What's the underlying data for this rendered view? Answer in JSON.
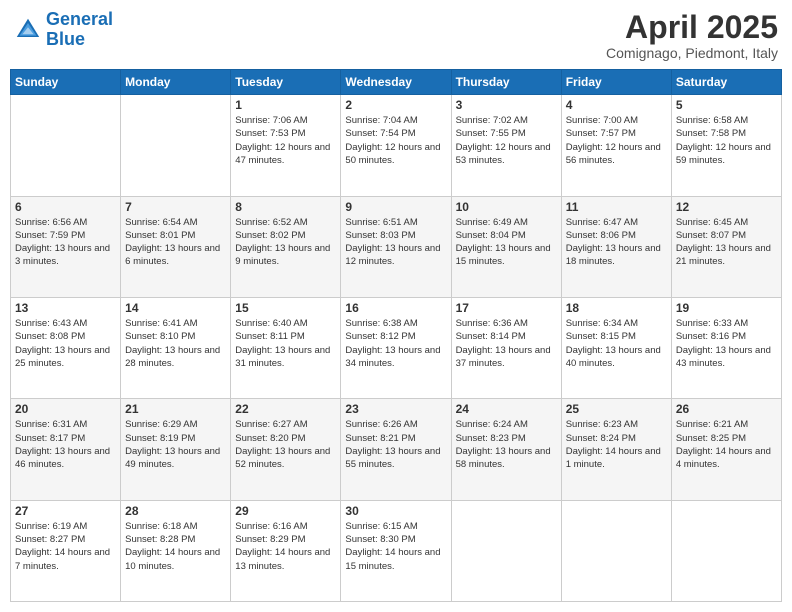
{
  "logo": {
    "line1": "General",
    "line2": "Blue"
  },
  "header": {
    "month": "April 2025",
    "location": "Comignago, Piedmont, Italy"
  },
  "weekdays": [
    "Sunday",
    "Monday",
    "Tuesday",
    "Wednesday",
    "Thursday",
    "Friday",
    "Saturday"
  ],
  "weeks": [
    [
      {
        "day": "",
        "sunrise": "",
        "sunset": "",
        "daylight": ""
      },
      {
        "day": "",
        "sunrise": "",
        "sunset": "",
        "daylight": ""
      },
      {
        "day": "1",
        "sunrise": "Sunrise: 7:06 AM",
        "sunset": "Sunset: 7:53 PM",
        "daylight": "Daylight: 12 hours and 47 minutes."
      },
      {
        "day": "2",
        "sunrise": "Sunrise: 7:04 AM",
        "sunset": "Sunset: 7:54 PM",
        "daylight": "Daylight: 12 hours and 50 minutes."
      },
      {
        "day": "3",
        "sunrise": "Sunrise: 7:02 AM",
        "sunset": "Sunset: 7:55 PM",
        "daylight": "Daylight: 12 hours and 53 minutes."
      },
      {
        "day": "4",
        "sunrise": "Sunrise: 7:00 AM",
        "sunset": "Sunset: 7:57 PM",
        "daylight": "Daylight: 12 hours and 56 minutes."
      },
      {
        "day": "5",
        "sunrise": "Sunrise: 6:58 AM",
        "sunset": "Sunset: 7:58 PM",
        "daylight": "Daylight: 12 hours and 59 minutes."
      }
    ],
    [
      {
        "day": "6",
        "sunrise": "Sunrise: 6:56 AM",
        "sunset": "Sunset: 7:59 PM",
        "daylight": "Daylight: 13 hours and 3 minutes."
      },
      {
        "day": "7",
        "sunrise": "Sunrise: 6:54 AM",
        "sunset": "Sunset: 8:01 PM",
        "daylight": "Daylight: 13 hours and 6 minutes."
      },
      {
        "day": "8",
        "sunrise": "Sunrise: 6:52 AM",
        "sunset": "Sunset: 8:02 PM",
        "daylight": "Daylight: 13 hours and 9 minutes."
      },
      {
        "day": "9",
        "sunrise": "Sunrise: 6:51 AM",
        "sunset": "Sunset: 8:03 PM",
        "daylight": "Daylight: 13 hours and 12 minutes."
      },
      {
        "day": "10",
        "sunrise": "Sunrise: 6:49 AM",
        "sunset": "Sunset: 8:04 PM",
        "daylight": "Daylight: 13 hours and 15 minutes."
      },
      {
        "day": "11",
        "sunrise": "Sunrise: 6:47 AM",
        "sunset": "Sunset: 8:06 PM",
        "daylight": "Daylight: 13 hours and 18 minutes."
      },
      {
        "day": "12",
        "sunrise": "Sunrise: 6:45 AM",
        "sunset": "Sunset: 8:07 PM",
        "daylight": "Daylight: 13 hours and 21 minutes."
      }
    ],
    [
      {
        "day": "13",
        "sunrise": "Sunrise: 6:43 AM",
        "sunset": "Sunset: 8:08 PM",
        "daylight": "Daylight: 13 hours and 25 minutes."
      },
      {
        "day": "14",
        "sunrise": "Sunrise: 6:41 AM",
        "sunset": "Sunset: 8:10 PM",
        "daylight": "Daylight: 13 hours and 28 minutes."
      },
      {
        "day": "15",
        "sunrise": "Sunrise: 6:40 AM",
        "sunset": "Sunset: 8:11 PM",
        "daylight": "Daylight: 13 hours and 31 minutes."
      },
      {
        "day": "16",
        "sunrise": "Sunrise: 6:38 AM",
        "sunset": "Sunset: 8:12 PM",
        "daylight": "Daylight: 13 hours and 34 minutes."
      },
      {
        "day": "17",
        "sunrise": "Sunrise: 6:36 AM",
        "sunset": "Sunset: 8:14 PM",
        "daylight": "Daylight: 13 hours and 37 minutes."
      },
      {
        "day": "18",
        "sunrise": "Sunrise: 6:34 AM",
        "sunset": "Sunset: 8:15 PM",
        "daylight": "Daylight: 13 hours and 40 minutes."
      },
      {
        "day": "19",
        "sunrise": "Sunrise: 6:33 AM",
        "sunset": "Sunset: 8:16 PM",
        "daylight": "Daylight: 13 hours and 43 minutes."
      }
    ],
    [
      {
        "day": "20",
        "sunrise": "Sunrise: 6:31 AM",
        "sunset": "Sunset: 8:17 PM",
        "daylight": "Daylight: 13 hours and 46 minutes."
      },
      {
        "day": "21",
        "sunrise": "Sunrise: 6:29 AM",
        "sunset": "Sunset: 8:19 PM",
        "daylight": "Daylight: 13 hours and 49 minutes."
      },
      {
        "day": "22",
        "sunrise": "Sunrise: 6:27 AM",
        "sunset": "Sunset: 8:20 PM",
        "daylight": "Daylight: 13 hours and 52 minutes."
      },
      {
        "day": "23",
        "sunrise": "Sunrise: 6:26 AM",
        "sunset": "Sunset: 8:21 PM",
        "daylight": "Daylight: 13 hours and 55 minutes."
      },
      {
        "day": "24",
        "sunrise": "Sunrise: 6:24 AM",
        "sunset": "Sunset: 8:23 PM",
        "daylight": "Daylight: 13 hours and 58 minutes."
      },
      {
        "day": "25",
        "sunrise": "Sunrise: 6:23 AM",
        "sunset": "Sunset: 8:24 PM",
        "daylight": "Daylight: 14 hours and 1 minute."
      },
      {
        "day": "26",
        "sunrise": "Sunrise: 6:21 AM",
        "sunset": "Sunset: 8:25 PM",
        "daylight": "Daylight: 14 hours and 4 minutes."
      }
    ],
    [
      {
        "day": "27",
        "sunrise": "Sunrise: 6:19 AM",
        "sunset": "Sunset: 8:27 PM",
        "daylight": "Daylight: 14 hours and 7 minutes."
      },
      {
        "day": "28",
        "sunrise": "Sunrise: 6:18 AM",
        "sunset": "Sunset: 8:28 PM",
        "daylight": "Daylight: 14 hours and 10 minutes."
      },
      {
        "day": "29",
        "sunrise": "Sunrise: 6:16 AM",
        "sunset": "Sunset: 8:29 PM",
        "daylight": "Daylight: 14 hours and 13 minutes."
      },
      {
        "day": "30",
        "sunrise": "Sunrise: 6:15 AM",
        "sunset": "Sunset: 8:30 PM",
        "daylight": "Daylight: 14 hours and 15 minutes."
      },
      {
        "day": "",
        "sunrise": "",
        "sunset": "",
        "daylight": ""
      },
      {
        "day": "",
        "sunrise": "",
        "sunset": "",
        "daylight": ""
      },
      {
        "day": "",
        "sunrise": "",
        "sunset": "",
        "daylight": ""
      }
    ]
  ]
}
